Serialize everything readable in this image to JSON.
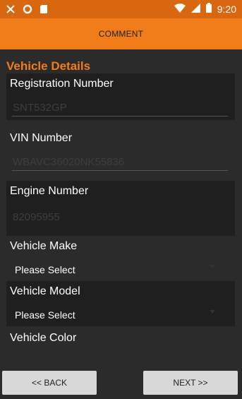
{
  "status_bar": {
    "time": "9:20",
    "icons": [
      "notification-icon",
      "circle-icon",
      "sd-card-icon",
      "wifi-icon",
      "signal-icon",
      "battery-icon"
    ]
  },
  "header": {
    "title": "COMMENT"
  },
  "section": {
    "title": "Vehicle Details"
  },
  "fields": {
    "registration": {
      "label": "Registration Number",
      "value": "SNT532GP"
    },
    "vin": {
      "label": "VIN Number",
      "value": "WBAVC36020NK55836"
    },
    "engine": {
      "label": "Engine Number",
      "value": "82095955"
    },
    "make": {
      "label": "Vehicle Make",
      "selected": "Please Select"
    },
    "model": {
      "label": "Vehicle Model",
      "selected": "Please Select"
    },
    "color": {
      "label": "Vehicle Color"
    }
  },
  "buttons": {
    "back": "<< BACK",
    "next": "NEXT >>"
  },
  "colors": {
    "accent": "#f07d1a",
    "status": "#d9670f",
    "background": "#2b2b2b"
  }
}
